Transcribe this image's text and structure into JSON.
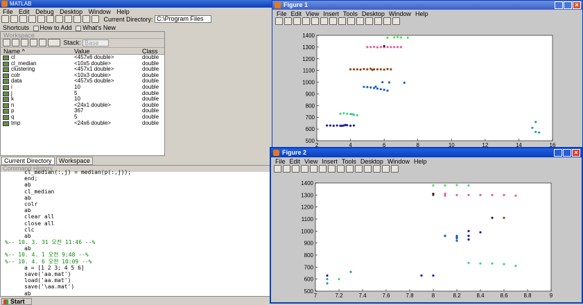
{
  "matlab": {
    "title": "MATLAB",
    "menu": [
      "File",
      "Edit",
      "Debug",
      "Desktop",
      "Window",
      "Help"
    ],
    "current_directory_label": "Current Directory:",
    "current_directory_value": "C:\\Program Files",
    "shortcuts": {
      "label": "Shortcuts",
      "how_to_add": "How to Add",
      "whats_new": "What's New"
    },
    "workspace": {
      "title": "Workspace",
      "stack_label": "Stack:",
      "stack_value": "Base",
      "columns": [
        "Name ^",
        "Value",
        "Class"
      ],
      "rows": [
        {
          "name": "cl",
          "value": "<457x6 double>",
          "cls": "double"
        },
        {
          "name": "cl_median",
          "value": "<10x5 double>",
          "cls": "double"
        },
        {
          "name": "clustering",
          "value": "<457x1 double>",
          "cls": "double"
        },
        {
          "name": "colr",
          "value": "<10x3 double>",
          "cls": "double"
        },
        {
          "name": "data",
          "value": "<457x5 double>",
          "cls": "double"
        },
        {
          "name": "i",
          "value": "10",
          "cls": "double"
        },
        {
          "name": "j",
          "value": "5",
          "cls": "double"
        },
        {
          "name": "k",
          "value": "10",
          "cls": "double"
        },
        {
          "name": "n",
          "value": "<24x1 double>",
          "cls": "double"
        },
        {
          "name": "p",
          "value": "367",
          "cls": "double"
        },
        {
          "name": "q",
          "value": "5",
          "cls": "double"
        },
        {
          "name": "tmp",
          "value": "<24x6 double>",
          "cls": "double"
        }
      ]
    },
    "tabs": [
      "Current Directory",
      "Workspace"
    ],
    "history": {
      "title": "Command History",
      "lines": [
        {
          "t": "cl_median(:,j) = median(p(:,j));",
          "k": "code"
        },
        {
          "t": "end;",
          "k": "code"
        },
        {
          "t": "ab",
          "k": "code"
        },
        {
          "t": "cl_median",
          "k": "code"
        },
        {
          "t": "ab",
          "k": "code"
        },
        {
          "t": "colr",
          "k": "code"
        },
        {
          "t": "ab",
          "k": "code"
        },
        {
          "t": "clear all",
          "k": "cmd"
        },
        {
          "t": "close all",
          "k": "cmd"
        },
        {
          "t": "clc",
          "k": "code"
        },
        {
          "t": "ab",
          "k": "code"
        },
        {
          "t": "%-- 10. 3. 31 오전 11:46 --%",
          "k": "session"
        },
        {
          "t": "ab",
          "k": "code"
        },
        {
          "t": "%-- 10. 4. 1  오전 9:48 --%",
          "k": "session"
        },
        {
          "t": "%-- 10. 4. 6 오전 10:09 --%",
          "k": "session"
        },
        {
          "t": "a = [1 2 3; 4 5 6]",
          "k": "code"
        },
        {
          "t": "save('aa.mat')",
          "k": "str"
        },
        {
          "t": "load('aa.mat')",
          "k": "str"
        },
        {
          "t": "save('\\aa.mat')",
          "k": "str"
        },
        {
          "t": "ab",
          "k": "code"
        }
      ]
    },
    "start": "Start"
  },
  "figures": [
    {
      "title": "Figure 1",
      "menu": [
        "File",
        "Edit",
        "View",
        "Insert",
        "Tools",
        "Desktop",
        "Window",
        "Help"
      ]
    },
    {
      "title": "Figure 2",
      "menu": [
        "File",
        "Edit",
        "View",
        "Insert",
        "Tools",
        "Desktop",
        "Window",
        "Help"
      ]
    }
  ],
  "colors": {
    "titlebar": "#0a4fd6",
    "fig_bg": "#c8c8c8",
    "plot_bg": "#ffffff"
  },
  "chart_data": [
    {
      "type": "scatter",
      "xlim": [
        2,
        16
      ],
      "ylim": [
        500,
        1400
      ],
      "xticks": [
        2,
        4,
        6,
        8,
        10,
        12,
        14,
        16
      ],
      "yticks": [
        500,
        600,
        700,
        800,
        900,
        1000,
        1100,
        1200,
        1300,
        1400
      ],
      "series": [
        {
          "color": "#1a1aa0",
          "points": [
            [
              2.6,
              630
            ],
            [
              2.8,
              630
            ],
            [
              3.0,
              628
            ],
            [
              3.2,
              630
            ],
            [
              3.4,
              628
            ],
            [
              3.6,
              630
            ],
            [
              3.8,
              632
            ],
            [
              4.0,
              628
            ],
            [
              4.2,
              630
            ],
            [
              3.7,
              635
            ],
            [
              3.5,
              627
            ]
          ]
        },
        {
          "color": "#3ccf8a",
          "points": [
            [
              3.4,
              730
            ],
            [
              3.6,
              735
            ],
            [
              3.8,
              730
            ],
            [
              4.0,
              728
            ],
            [
              4.2,
              722
            ],
            [
              4.4,
              718
            ],
            [
              4.1,
              726
            ]
          ]
        },
        {
          "color": "#1565c0",
          "points": [
            [
              4.8,
              960
            ],
            [
              5.0,
              958
            ],
            [
              5.2,
              955
            ],
            [
              5.4,
              950
            ],
            [
              5.6,
              945
            ],
            [
              5.8,
              940
            ],
            [
              6.0,
              935
            ],
            [
              6.2,
              928
            ],
            [
              5.9,
              1000
            ],
            [
              6.3,
              998
            ],
            [
              7.2,
              995
            ],
            [
              5.5,
              962
            ]
          ]
        },
        {
          "color": "#8b4513",
          "points": [
            [
              4.0,
              1110
            ],
            [
              4.2,
              1110
            ],
            [
              4.4,
              1110
            ],
            [
              4.6,
              1108
            ],
            [
              4.8,
              1112
            ],
            [
              5.0,
              1110
            ],
            [
              5.2,
              1115
            ],
            [
              5.4,
              1110
            ],
            [
              5.6,
              1110
            ],
            [
              5.8,
              1110
            ],
            [
              6.0,
              1108
            ],
            [
              6.2,
              1112
            ],
            [
              6.4,
              1110
            ],
            [
              5.3,
              1105
            ]
          ]
        },
        {
          "color": "#e8589c",
          "points": [
            [
              5.0,
              1300
            ],
            [
              5.2,
              1300
            ],
            [
              5.4,
              1302
            ],
            [
              5.6,
              1298
            ],
            [
              5.8,
              1300
            ],
            [
              6.0,
              1300
            ],
            [
              6.2,
              1300
            ],
            [
              6.4,
              1300
            ],
            [
              6.6,
              1300
            ],
            [
              6.8,
              1300
            ],
            [
              7.0,
              1300
            ]
          ]
        },
        {
          "color": "#222222",
          "points": [
            [
              6.0,
              1308
            ]
          ]
        },
        {
          "color": "#4ae65a",
          "points": [
            [
              6.2,
              1380
            ],
            [
              6.6,
              1382
            ],
            [
              7.0,
              1382
            ],
            [
              7.4,
              1380
            ],
            [
              6.8,
              1385
            ]
          ]
        },
        {
          "color": "#2a9d9d",
          "points": [
            [
              14.8,
              610
            ],
            [
              15.0,
              660
            ],
            [
              15.2,
              570
            ],
            [
              15.0,
              575
            ]
          ]
        }
      ]
    },
    {
      "type": "scatter",
      "xlim": [
        7,
        9
      ],
      "ylim": [
        500,
        1400
      ],
      "xticks": [
        7,
        7.2,
        7.4,
        7.6,
        7.8,
        8,
        8.2,
        8.4,
        8.6,
        8.8,
        9
      ],
      "yticks": [
        500,
        600,
        700,
        800,
        900,
        1000,
        1100,
        1200,
        1300,
        1400
      ],
      "series": [
        {
          "color": "#2a9d9d",
          "points": [
            [
              7.1,
              565
            ],
            [
              7.1,
              600
            ],
            [
              7.3,
              660
            ]
          ]
        },
        {
          "color": "#3ccf8a",
          "points": [
            [
              7.2,
              600
            ],
            [
              8.4,
              730
            ],
            [
              8.5,
              730
            ],
            [
              8.6,
              725
            ],
            [
              8.7,
              710
            ],
            [
              8.3,
              735
            ]
          ]
        },
        {
          "color": "#1a1aa0",
          "points": [
            [
              7.1,
              630
            ],
            [
              7.9,
              630
            ],
            [
              8.0,
              630
            ],
            [
              8.1,
              960
            ],
            [
              8.2,
              950
            ],
            [
              8.3,
              1000
            ],
            [
              8.4,
              990
            ],
            [
              8.3,
              960
            ],
            [
              8.3,
              930
            ]
          ]
        },
        {
          "color": "#1565c0",
          "points": [
            [
              8.2,
              920
            ],
            [
              8.2,
              940
            ],
            [
              8.2,
              960
            ],
            [
              8.1,
              960
            ]
          ]
        },
        {
          "color": "#8b4513",
          "points": [
            [
              8.0,
              1300
            ],
            [
              8.6,
              1110
            ]
          ]
        },
        {
          "color": "#e8589c",
          "points": [
            [
              8.1,
              1295
            ],
            [
              8.2,
              1300
            ],
            [
              8.3,
              1300
            ],
            [
              8.4,
              1300
            ],
            [
              8.5,
              1300
            ],
            [
              8.6,
              1300
            ],
            [
              8.7,
              1295
            ],
            [
              8.1,
              1310
            ]
          ]
        },
        {
          "color": "#4ae65a",
          "points": [
            [
              8.0,
              1380
            ],
            [
              8.1,
              1380
            ],
            [
              8.2,
              1382
            ],
            [
              8.3,
              1380
            ]
          ]
        },
        {
          "color": "#222222",
          "points": [
            [
              8.0,
              1310
            ],
            [
              8.5,
              1110
            ]
          ]
        }
      ]
    }
  ]
}
